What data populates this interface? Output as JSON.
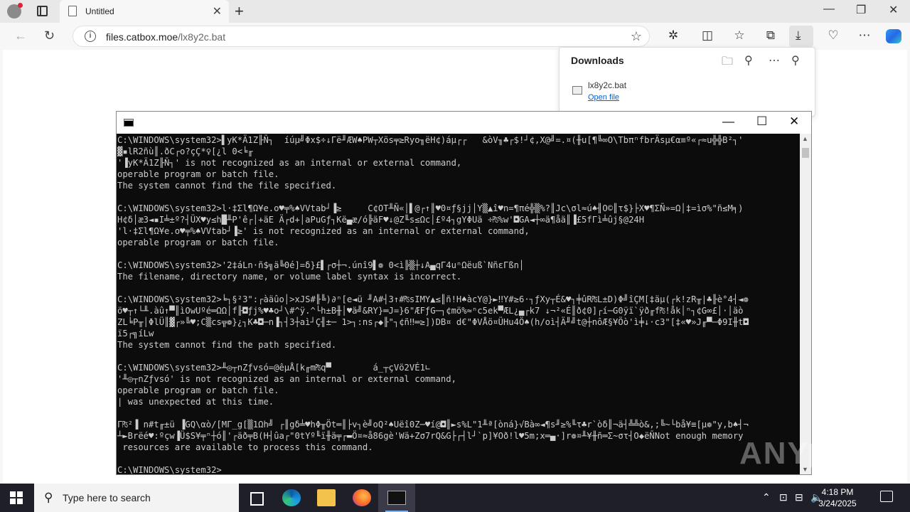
{
  "browser": {
    "tab_title": "Untitled",
    "url_host": "files.catbox.moe",
    "url_path": "/lx8y2c.bat"
  },
  "downloads": {
    "header": "Downloads",
    "file_name": "lx8y2c.bat",
    "open_link": "Open file"
  },
  "console": {
    "lines": [
      "C:\\WINDOWS\\system32>▌yK*Ä1Z╟Ñ┐  íúµ╝Φx$÷↓Γë╜ÆW♠PW┬Xös╤≥Ryo╖ëH¢)áµ┌┌   &òV╖♣┌$!┘¢,X@╝=.¤(╫u[¶╚∞O\\TbπⁿfbrÄsµ€α≡º«┌≈u╬╬B²┐'",
      "▓▪lR2ñù║.ðC┌o?çÇ*♀[¿l 0<╘╓",
      "'▐yK*Ä1Z╟Ñ┐' is not recognized as an internal or external command,",
      "operable program or batch file.",
      "The system cannot find the file specified.",
      "",
      "C:\\WINDOWS\\system32>l·‡Σl¶Ω¥e.o♥╤%♠VVtab┘▐≥     C¢OT╨Ñ«│▌@┌↑║♥0¤ƒ§jj│Y▒▲î♥n=¶πé╬▒%?║Jc\\σl≈ú♠╢O©║τ$}├X♥¶ΣÑ»=Ω│‡=ìσ%\"ñ≤M╕)",
      "H¢δ│æ3◄▪I╧±º?┤ÜX♥y≤h█╨P'ê┌│+äE Ä┌d+│aPuGƒ┐Kë▄æ/ó╠äF♥↓@Z╙s≤Ωc│£º4┐gYΦUä ÷₧%w'◘GA◄┼∞ä¶åä║▐£5fΓì╧ûj§@24H",
      "'l·‡Σl¶Ω¥e.o♥╤%♠VVtab┘▐≥' is not recognized as an internal or external command,",
      "operable program or batch file.",
      "",
      "C:\\WINDOWS\\system32>'2‡áLn·ñ$╗ä╚0é]=δ}£▌┌σ┼¬.únî9▌❁ 0<ì╠▒┼↓A▄qΓ4uⁿΩëuß`NñεΓßn│",
      "The filename, directory name, or volume label syntax is incorrect.",
      "",
      "C:\\WINDOWS\\system32>╘┐§²3\":┌àäûo│>xJS#╟╚)∂ⁿ[e◄ü ╜A#┤3↑#₧sIMY▲≤║ñ!H♠àcY@}►‼Y#≥6·┐ƒXy┬É&♥┐╪ûR₧L±D)Φ╝îÇM[‡äµ(┌k!zR╥|♣╟è°4┤◄❁",
      "ö♥┬↑└╨.àû↑▀║ìOwUºé═ΩΩ│f╟◘ƒj%♥♣o┘\\#^ÿ.^└h±B╫│♥ä╝&RY}═J=}6\"ÆFƒG─┐¢mö%≈ⁿc5ek▀ÆL¿▄┌k7 ↓¬²«É║ð¢0]┌í─G0ÿï`ÿð╓f₧!åk│ⁿ┐¢G∞£│·│äò",
      "ZL╘P╥│ΦlÜ║▓┌»╚♥;C▒cs╦❁}¿┐K♣◘─n▐┐┤3┼aì┘Ç╢±─ 1>┐:ns┌◆╟\"┐¢ñ‼═≥])DB¤ d€\"ΦVÅö¤ÜHu4Ö♠(h/oì┤Ä╜╝t@┼nôÆ§¥Öò'ì╪↓·c3\"[‡«♥»J╓▀─Φ9I╫t◘",
      "ï5┌╗íLw",
      "The system cannot find the path specified.",
      "",
      "C:\\WINDOWS\\system32>╨◎┬nZƒvsó=@êµÅ[k╓m₧q▀        á_┬çVö2VÉ1∟",
      "'╨◎┬nZƒvsó' is not recognized as an internal or external command,",
      "operable program or batch file.",
      "| was unexpected at this time.",
      "",
      "Γ₧²▐ n#t╓±ü ▐GQ\\αò/[MΓ_g[▒1Ωh╝ ┌║gδ╧♥hΦ╥Öt═║├v┐è╝oQ²♠Uëî0Z─♥í@◘║►s%L\"1╨ª[òná}√Bà∞◄¶s╜≥%╙τ♣r`òδ║¬ä┤╩╩ò&,;╚~└bå¥≡[µ❁\"y,b♠┤¬",
      "┴►Brëé♥:ºçw▐Ü$S¥╤ⁿ┼ó║'┌äð╤B(H┤ûa┌\"0tYº╙ï╫ä╤┌▬Ö¤≈å86gè'Wä+Zσ7rQ&G├┌┤l┘`p]¥Oð!l♥5m;x═▄·]r❁¤╨¥╫ñ═Σ~στ┤O◆ëÑNot enough memory",
      " resources are available to process this command.",
      "",
      "C:\\WINDOWS\\system32>_"
    ]
  },
  "watermark": "ANY▷RUN",
  "taskbar": {
    "search_placeholder": "Type here to search",
    "time": "4:18 PM",
    "date": "3/24/2025"
  }
}
